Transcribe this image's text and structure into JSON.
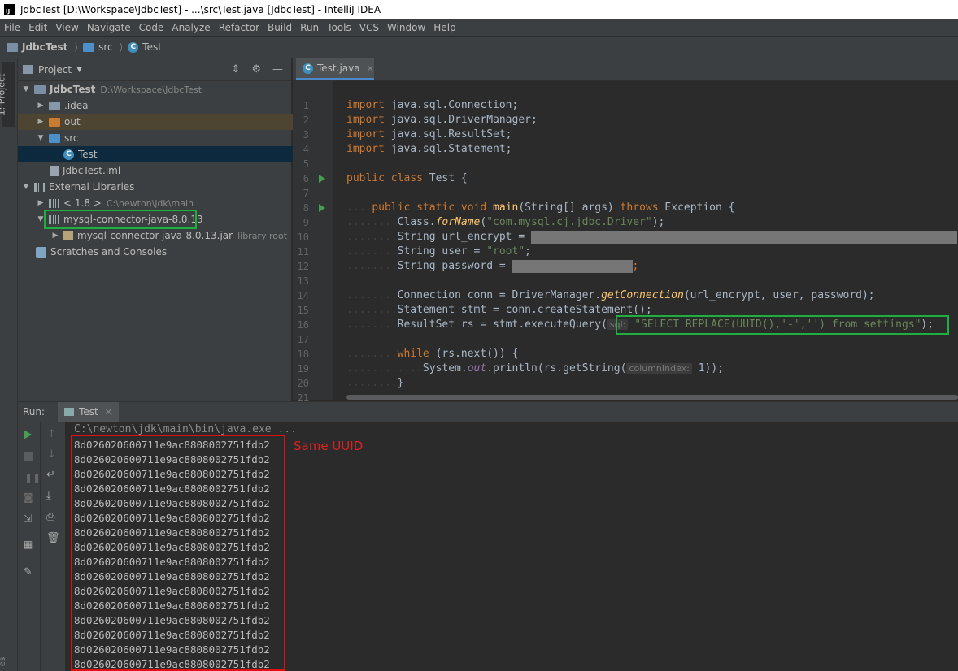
{
  "window": {
    "title": "JdbcTest [D:\\Workspace\\JdbcTest] - ...\\src\\Test.java [JdbcTest] - IntelliJ IDEA",
    "app_icon": "IJ"
  },
  "menu": [
    "File",
    "Edit",
    "View",
    "Navigate",
    "Code",
    "Analyze",
    "Refactor",
    "Build",
    "Run",
    "Tools",
    "VCS",
    "Window",
    "Help"
  ],
  "breadcrumb": [
    "JdbcTest",
    "src",
    "Test"
  ],
  "left_strip": {
    "tab": "1: Project",
    "bottom": "es"
  },
  "project": {
    "title": "Project",
    "tree": [
      {
        "label": "JdbcTest",
        "extra": "D:\\Workspace\\JdbcTest"
      },
      {
        "label": ".idea"
      },
      {
        "label": "out"
      },
      {
        "label": "src"
      },
      {
        "label": "Test"
      },
      {
        "label": "JdbcTest.iml"
      },
      {
        "label": "External Libraries"
      },
      {
        "label": "< 1.8 >",
        "extra": "C:\\newton\\jdk\\main"
      },
      {
        "label": "mysql-connector-java-8.0.13"
      },
      {
        "label": "mysql-connector-java-8.0.13.jar",
        "extra": "library root"
      },
      {
        "label": "Scratches and Consoles"
      }
    ]
  },
  "editor": {
    "tab": "Test.java",
    "line_numbers": [
      "1",
      "2",
      "3",
      "4",
      "5",
      "6",
      "7",
      "8",
      "9",
      "10",
      "11",
      "12",
      "13",
      "14",
      "15",
      "16",
      "17",
      "18",
      "19",
      "20",
      "21"
    ],
    "lines": {
      "l1": "java.sql.Connection;",
      "l2": "java.sql.DriverManager;",
      "l3": "java.sql.ResultSet;",
      "l4": "java.sql.Statement;",
      "kw_import": "import",
      "kw_public": "public",
      "kw_class": "class",
      "class_name": "Test {",
      "kw_static": "static",
      "kw_void": "void",
      "main_fn": "main",
      "main_args": "(String[] args)",
      "kw_throws": "throws",
      "main_exc": "Exception {",
      "l9a": "Class.",
      "l9b": "forName",
      "l9c": "(",
      "l9d": "\"com.mysql.cj.jdbc.Driver\"",
      "l9e": ");",
      "l10": "String url_encrypt =",
      "l11a": "String user =",
      "l11b": "\"root\"",
      "l11c": ";",
      "l12": "String password =",
      "l12b": ";",
      "l14a": "Connection conn = DriverManager.",
      "l14b": "getConnection",
      "l14c": "(url_encrypt, user, password);",
      "l15": "Statement stmt = conn.createStatement();",
      "l16a": "ResultSet rs = stmt.executeQuery(",
      "l16hint": "sql:",
      "l16b": "\"SELECT REPLACE(UUID(),'-','') from settings\"",
      "l16c": ");",
      "kw_while": "while",
      "l18": "(rs.next()) {",
      "l19a": "System.",
      "l19b": "out",
      "l19c": ".println(rs.getString(",
      "l19hint": "columnIndex:",
      "l19d": "1",
      "l19e": "));",
      "l20": "}"
    }
  },
  "run": {
    "label": "Run:",
    "tab": "Test",
    "command": "C:\\newton\\jdk\\main\\bin\\java.exe ...",
    "output": [
      "8d026020600711e9ac8808002751fdb2",
      "8d026020600711e9ac8808002751fdb2",
      "8d026020600711e9ac8808002751fdb2",
      "8d026020600711e9ac8808002751fdb2",
      "8d026020600711e9ac8808002751fdb2",
      "8d026020600711e9ac8808002751fdb2",
      "8d026020600711e9ac8808002751fdb2",
      "8d026020600711e9ac8808002751fdb2",
      "8d026020600711e9ac8808002751fdb2",
      "8d026020600711e9ac8808002751fdb2",
      "8d026020600711e9ac8808002751fdb2",
      "8d026020600711e9ac8808002751fdb2",
      "8d026020600711e9ac8808002751fdb2",
      "8d026020600711e9ac8808002751fdb2",
      "8d026020600711e9ac8808002751fdb2",
      "8d026020600711e9ac8808002751fdb2"
    ],
    "annotation": "Same UUID"
  },
  "colors": {
    "highlight_green": "#1faf3f",
    "highlight_red": "#e01010"
  }
}
